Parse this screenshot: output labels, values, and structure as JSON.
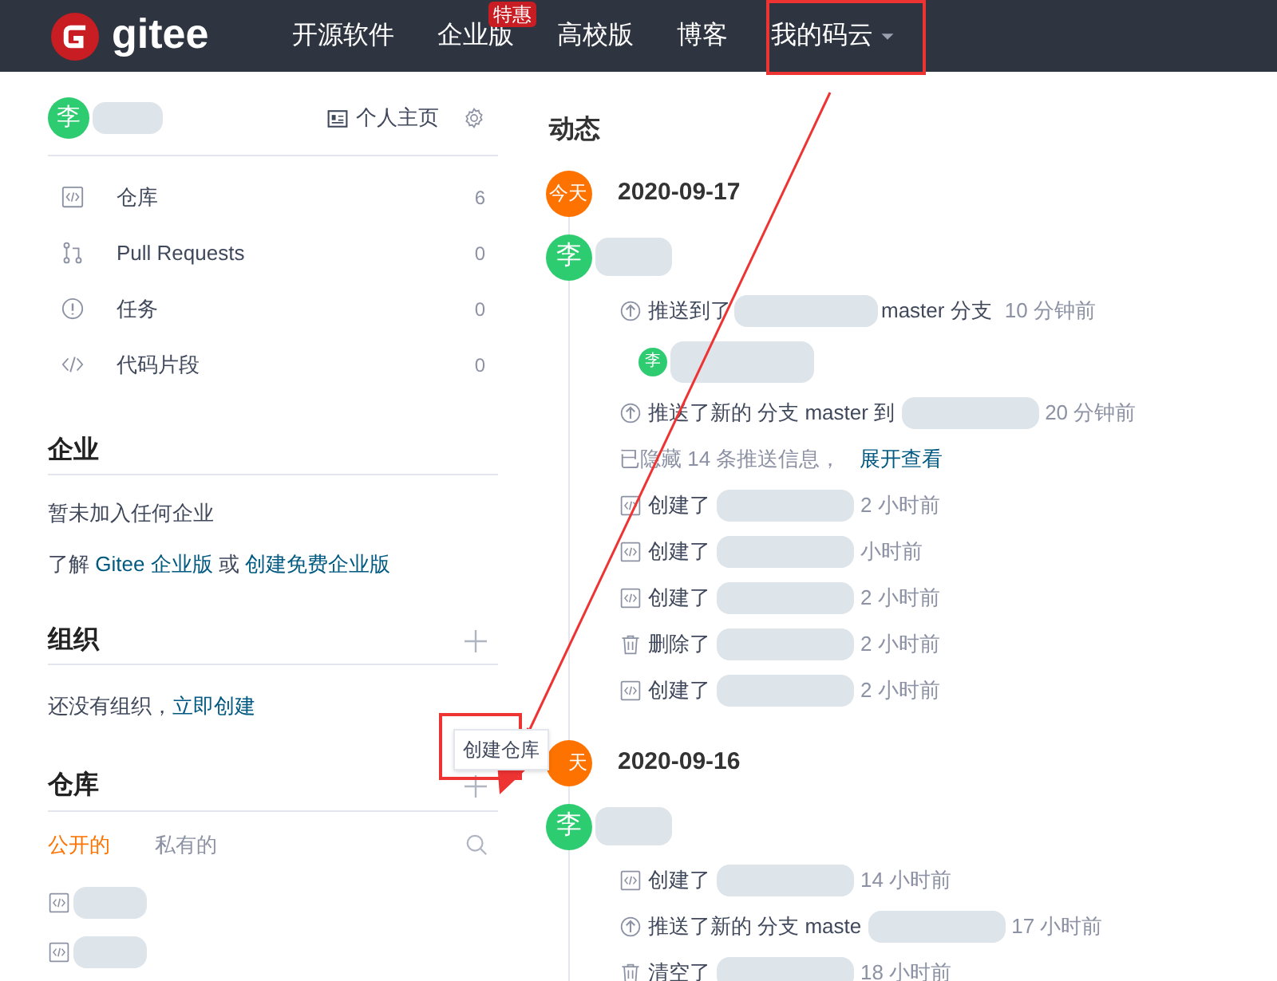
{
  "header": {
    "logo": "gitee",
    "nav": [
      {
        "label": "开源软件"
      },
      {
        "label": "企业版",
        "badge": "特惠"
      },
      {
        "label": "高校版"
      },
      {
        "label": "博客"
      },
      {
        "label": "我的码云",
        "dropdown": true
      }
    ]
  },
  "sidebar": {
    "user": {
      "avatar": "李"
    },
    "home_link": "个人主页",
    "menu": [
      {
        "label": "仓库",
        "count": "6"
      },
      {
        "label": "Pull Requests",
        "count": "0"
      },
      {
        "label": "任务",
        "count": "0"
      },
      {
        "label": "代码片段",
        "count": "0"
      }
    ],
    "enterprise": {
      "title": "企业",
      "empty": "暂未加入任何企业",
      "prefix": "了解",
      "link_1": "Gitee 企业版",
      "middle": "或",
      "link_2": "创建免费企业版"
    },
    "organization": {
      "title": "组织",
      "text": "还没有组织，",
      "link": "立即创建"
    },
    "repositories": {
      "title": "仓库",
      "tooltip": "创建仓库",
      "tabs": [
        {
          "label": "公开的",
          "selected": true
        },
        {
          "label": "私有的",
          "selected": false
        }
      ]
    }
  },
  "feed": {
    "title": "动态",
    "days": [
      {
        "badge": "今天",
        "date": "2020-09-17",
        "avatar": "李",
        "events": [
          {
            "kind": "push",
            "text": "推送到了",
            "after": "master 分支",
            "time": "10 分钟前"
          },
          {
            "kind": "commit",
            "avatar": "李"
          },
          {
            "kind": "push",
            "text": "推送了新的 分支 master 到",
            "time": "20 分钟前"
          },
          {
            "kind": "hidden",
            "text": "已隐藏 14 条推送信息，",
            "link": "展开查看"
          },
          {
            "kind": "create",
            "text": "创建了",
            "time": "2 小时前"
          },
          {
            "kind": "create",
            "text": "创建了",
            "time": "小时前"
          },
          {
            "kind": "create",
            "text": "创建了",
            "time": "2 小时前"
          },
          {
            "kind": "delete",
            "text": "删除了",
            "time": "2 小时前"
          },
          {
            "kind": "create",
            "text": "创建了",
            "time": "2 小时前"
          }
        ]
      },
      {
        "badge": "天",
        "date": "2020-09-16",
        "avatar": "李",
        "events": [
          {
            "kind": "create",
            "text": "创建了",
            "time": "14 小时前"
          },
          {
            "kind": "push",
            "text": "推送了新的 分支 maste",
            "time": "17 小时前"
          },
          {
            "kind": "delete",
            "text": "清空了",
            "time": "18 小时前"
          }
        ]
      }
    ]
  }
}
